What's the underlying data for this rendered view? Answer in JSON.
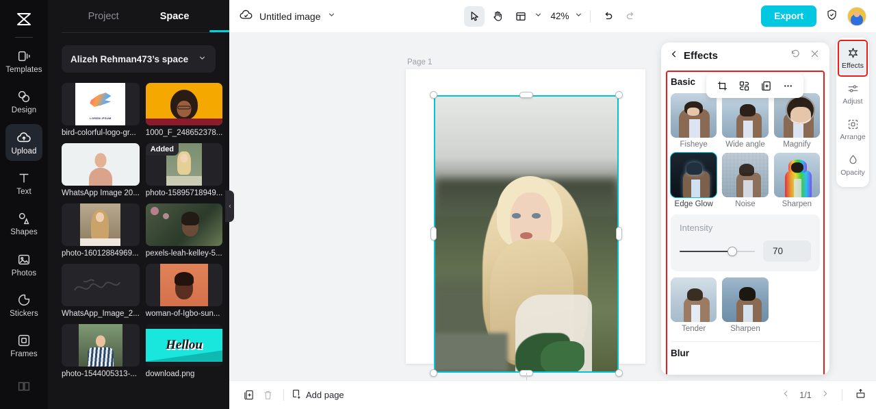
{
  "rail": {
    "logo_icon": "capcut-logo-icon",
    "items": [
      {
        "label": "Templates",
        "icon": "templates-icon",
        "active": false
      },
      {
        "label": "Design",
        "icon": "design-icon",
        "active": false
      },
      {
        "label": "Upload",
        "icon": "upload-cloud-icon",
        "active": true
      },
      {
        "label": "Text",
        "icon": "text-t-icon",
        "active": false
      },
      {
        "label": "Shapes",
        "icon": "shapes-icon",
        "active": false
      },
      {
        "label": "Photos",
        "icon": "photos-icon",
        "active": false
      },
      {
        "label": "Stickers",
        "icon": "stickers-icon",
        "active": false
      },
      {
        "label": "Frames",
        "icon": "frames-icon",
        "active": false
      },
      {
        "label": "",
        "icon": "book-icon",
        "active": false
      }
    ]
  },
  "left_panel": {
    "tabs": [
      {
        "label": "Project",
        "active": false
      },
      {
        "label": "Space",
        "active": true
      }
    ],
    "space_selector": {
      "label": "Alizeh Rehman473’s space",
      "chevron_icon": "chevron-down-icon"
    },
    "assets": [
      {
        "name": "bird-colorful-logo-gr...",
        "badge": ""
      },
      {
        "name": "1000_F_248652378...",
        "badge": ""
      },
      {
        "name": "WhatsApp Image 20...",
        "badge": ""
      },
      {
        "name": "photo-15895718949...",
        "badge": "Added"
      },
      {
        "name": "photo-16012884969...",
        "badge": ""
      },
      {
        "name": "pexels-leah-kelley-5...",
        "badge": ""
      },
      {
        "name": "WhatsApp_Image_2...",
        "badge": ""
      },
      {
        "name": "woman-of-Igbo-sun...",
        "badge": ""
      },
      {
        "name": "photo-1544005313-...",
        "badge": ""
      },
      {
        "name": "download.png",
        "badge": ""
      }
    ],
    "collapse_icon": "chevron-left-icon"
  },
  "topbar": {
    "cloud_icon": "cloud-saved-icon",
    "doc_title": "Untitled image",
    "title_chevron_icon": "chevron-down-icon",
    "tools": [
      {
        "name": "select-tool",
        "icon": "cursor-arrow-icon",
        "selected": true
      },
      {
        "name": "hand-tool",
        "icon": "hand-icon",
        "selected": false
      },
      {
        "name": "layout-tool",
        "icon": "layout-grid-icon",
        "selected": false
      }
    ],
    "layout_chevron_icon": "chevron-down-icon",
    "zoom_level": "42%",
    "zoom_chevron_icon": "chevron-down-icon",
    "undo_icon": "undo-arrow-icon",
    "redo_icon": "redo-arrow-icon",
    "export_label": "Export",
    "shield_icon": "shield-check-icon",
    "avatar_icon": "user-avatar"
  },
  "canvas": {
    "page_label": "Page 1",
    "floating_tools": [
      {
        "name": "crop-button",
        "icon": "crop-icon"
      },
      {
        "name": "remove-background-button",
        "icon": "cutout-icon"
      },
      {
        "name": "duplicate-button",
        "icon": "duplicate-icon"
      },
      {
        "name": "more-options-button",
        "icon": "ellipsis-icon"
      }
    ],
    "rotate_icon": "rotate-icon",
    "selection_color": "#00c4d4"
  },
  "effects_panel": {
    "back_icon": "chevron-left-icon",
    "title": "Effects",
    "reset_icon": "reset-circle-icon",
    "close_icon": "close-x-icon",
    "sections": [
      {
        "title": "Basic",
        "row1": [
          {
            "label": "Fisheye",
            "selected": false
          },
          {
            "label": "Wide angle",
            "selected": false
          },
          {
            "label": "Magnify",
            "selected": false
          }
        ],
        "row2": [
          {
            "label": "Edge Glow",
            "selected": true
          },
          {
            "label": "Noise",
            "selected": false
          },
          {
            "label": "Sharpen",
            "selected": false
          }
        ],
        "row3": [
          {
            "label": "Tender",
            "selected": false
          },
          {
            "label": "Sharpen",
            "selected": false
          }
        ]
      }
    ],
    "intensity": {
      "label": "Intensity",
      "value": "70",
      "percent": 70
    },
    "next_section_title": "Blur",
    "highlight_color": "#ef1b1b"
  },
  "right_rail": {
    "items": [
      {
        "label": "Effects",
        "icon": "effects-star-icon",
        "active": true
      },
      {
        "label": "Adjust",
        "icon": "adjust-sliders-icon",
        "active": false
      },
      {
        "label": "Arrange",
        "icon": "arrange-icon",
        "active": false
      },
      {
        "label": "Opacity",
        "icon": "opacity-drop-icon",
        "active": false
      }
    ]
  },
  "bottombar": {
    "duplicate_page_icon": "duplicate-page-icon",
    "delete_page_icon": "trash-icon",
    "add_page_icon": "add-page-icon",
    "add_page_label": "Add page",
    "prev_icon": "chevron-left-icon",
    "page_indicator": "1/1",
    "next_icon": "chevron-right-icon",
    "export_page_icon": "upload-tray-icon"
  }
}
